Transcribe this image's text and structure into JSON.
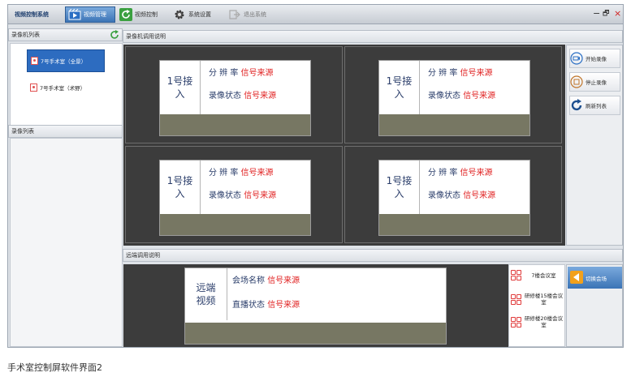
{
  "window": {
    "app_name": "视频控制系统",
    "nav": [
      {
        "label": "视频管理",
        "icon": "video-icon",
        "active": true
      },
      {
        "label": "视频控制",
        "icon": "refresh-icon",
        "active": false
      },
      {
        "label": "系统设置",
        "icon": "gear-icon",
        "active": false
      },
      {
        "label": "退出系统",
        "icon": "exit-icon",
        "active": false
      }
    ],
    "controls": {
      "minimize": "−",
      "restore": "🗗",
      "close": "×"
    }
  },
  "left_panel": {
    "recorder_list_title": "录像机列表",
    "recorders": [
      {
        "label": "7号手术室（全景）",
        "selected": true
      },
      {
        "label": "7号手术室（术野）",
        "selected": false
      }
    ],
    "video_list_title": "录像列表"
  },
  "recorder_panel": {
    "title": "录像机调用说明",
    "cells": [
      {
        "name_line1": "1号接",
        "name_line2": "入",
        "resolution_label": "分 辨 率",
        "resolution_value": "信号来源",
        "status_label": "录像状态",
        "status_value": "信号来源"
      },
      {
        "name_line1": "1号接",
        "name_line2": "入",
        "resolution_label": "分 辨 率",
        "resolution_value": "信号来源",
        "status_label": "录像状态",
        "status_value": "信号来源"
      },
      {
        "name_line1": "1号接",
        "name_line2": "入",
        "resolution_label": "分 辨 率",
        "resolution_value": "信号来源",
        "status_label": "录像状态",
        "status_value": "信号来源"
      },
      {
        "name_line1": "1号接",
        "name_line2": "入",
        "resolution_label": "分 辨 率",
        "resolution_value": "信号来源",
        "status_label": "录像状态",
        "status_value": "信号来源"
      }
    ]
  },
  "record_controls": {
    "start": "开始录像",
    "stop": "停止录像",
    "refresh": "刷新列表"
  },
  "remote_panel": {
    "title": "远端调用说明",
    "name_line1": "远端",
    "name_line2": "视频",
    "venue_label": "会场名称",
    "venue_value": "信号来源",
    "live_label": "直播状态",
    "live_value": "信号来源"
  },
  "rooms": [
    {
      "label": "7楼会议室"
    },
    {
      "label": "研修楼15楼会议室"
    },
    {
      "label": "研修楼20楼会议室"
    }
  ],
  "switch_button": "切换会场",
  "caption": "手术室控制屏软件界面2",
  "colors": {
    "accent_blue": "#3b74b6",
    "signal_red": "#e02020",
    "panel_dark": "#3c3c3c",
    "card_footer": "#777763"
  }
}
